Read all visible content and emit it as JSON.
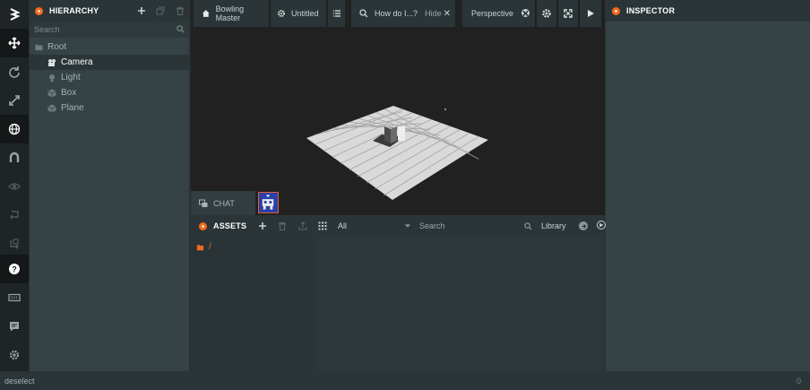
{
  "toolbar": {
    "tools": [
      "logo",
      "move-icon",
      "rotate-icon",
      "scale-icon",
      "globe-icon",
      "magnet-icon",
      "eye-icon",
      "undo-icon",
      "redo-icon",
      "help-icon",
      "keyboard-icon",
      "chat-icon",
      "settings-icon"
    ]
  },
  "hierarchy": {
    "title": "HIERARCHY",
    "search_placeholder": "Search",
    "root_label": "Root",
    "items": [
      {
        "label": "Camera",
        "icon": "camera-icon",
        "selected": true
      },
      {
        "label": "Light",
        "icon": "light-icon",
        "selected": false
      },
      {
        "label": "Box",
        "icon": "cube-icon",
        "selected": false
      },
      {
        "label": "Plane",
        "icon": "cube-icon",
        "selected": false
      }
    ]
  },
  "viewport": {
    "project_name": "Bowling Master",
    "scene_name": "Untitled",
    "help_text": "How do I...?",
    "hide_label": "Hide",
    "camera_label": "Perspective"
  },
  "chat": {
    "label": "CHAT"
  },
  "assets": {
    "title": "ASSETS",
    "filter_value": "All",
    "search_placeholder": "Search",
    "library_label": "Library",
    "path_label": "/"
  },
  "inspector": {
    "title": "INSPECTOR"
  },
  "status": {
    "message": "deselect",
    "count": "0"
  },
  "colors": {
    "accent": "#f26a21",
    "panel": "#364346",
    "header": "#2b3537",
    "toolbar": "#1f2426",
    "viewport": "#212121"
  }
}
